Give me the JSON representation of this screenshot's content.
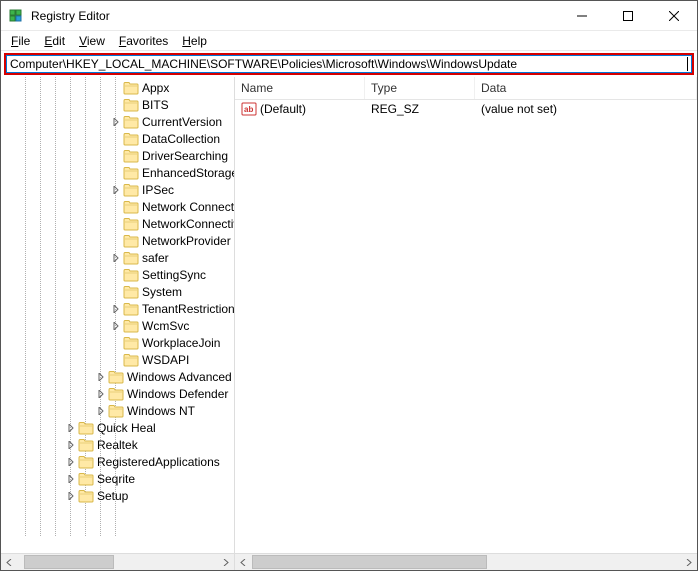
{
  "window": {
    "title": "Registry Editor"
  },
  "menu": {
    "file": "File",
    "edit": "Edit",
    "view": "View",
    "favorites": "Favorites",
    "help": "Help"
  },
  "address": {
    "path": "Computer\\HKEY_LOCAL_MACHINE\\SOFTWARE\\Policies\\Microsoft\\Windows\\WindowsUpdate"
  },
  "tree": {
    "items": [
      {
        "indent": 7,
        "expander": "none",
        "label": "Appx"
      },
      {
        "indent": 7,
        "expander": "none",
        "label": "BITS"
      },
      {
        "indent": 7,
        "expander": "collapsed",
        "label": "CurrentVersion"
      },
      {
        "indent": 7,
        "expander": "none",
        "label": "DataCollection"
      },
      {
        "indent": 7,
        "expander": "none",
        "label": "DriverSearching"
      },
      {
        "indent": 7,
        "expander": "none",
        "label": "EnhancedStorageDevices"
      },
      {
        "indent": 7,
        "expander": "collapsed",
        "label": "IPSec"
      },
      {
        "indent": 7,
        "expander": "none",
        "label": "Network Connections"
      },
      {
        "indent": 7,
        "expander": "none",
        "label": "NetworkConnectivityStatusIndicator"
      },
      {
        "indent": 7,
        "expander": "none",
        "label": "NetworkProvider"
      },
      {
        "indent": 7,
        "expander": "collapsed",
        "label": "safer"
      },
      {
        "indent": 7,
        "expander": "none",
        "label": "SettingSync"
      },
      {
        "indent": 7,
        "expander": "none",
        "label": "System"
      },
      {
        "indent": 7,
        "expander": "collapsed",
        "label": "TenantRestrictions"
      },
      {
        "indent": 7,
        "expander": "collapsed",
        "label": "WcmSvc"
      },
      {
        "indent": 7,
        "expander": "none",
        "label": "WorkplaceJoin"
      },
      {
        "indent": 7,
        "expander": "none",
        "label": "WSDAPI"
      },
      {
        "indent": 6,
        "expander": "collapsed",
        "label": "Windows Advanced Threat Protection"
      },
      {
        "indent": 6,
        "expander": "collapsed",
        "label": "Windows Defender"
      },
      {
        "indent": 6,
        "expander": "collapsed",
        "label": "Windows NT"
      },
      {
        "indent": 4,
        "expander": "collapsed",
        "label": "Quick Heal"
      },
      {
        "indent": 4,
        "expander": "collapsed",
        "label": "Realtek"
      },
      {
        "indent": 4,
        "expander": "collapsed",
        "label": "RegisteredApplications"
      },
      {
        "indent": 4,
        "expander": "collapsed",
        "label": "Seqrite"
      },
      {
        "indent": 4,
        "expander": "collapsed",
        "label": "Setup"
      }
    ],
    "max_depth_lines": 7
  },
  "list": {
    "headers": {
      "name": "Name",
      "type": "Type",
      "data": "Data"
    },
    "rows": [
      {
        "icon": "ab",
        "name": "(Default)",
        "type": "REG_SZ",
        "data": "(value not set)"
      }
    ]
  },
  "scroll": {
    "tree_thumb_left_pct": 3,
    "tree_thumb_width_pct": 45,
    "list_thumb_left_pct": 0,
    "list_thumb_width_pct": 55
  }
}
